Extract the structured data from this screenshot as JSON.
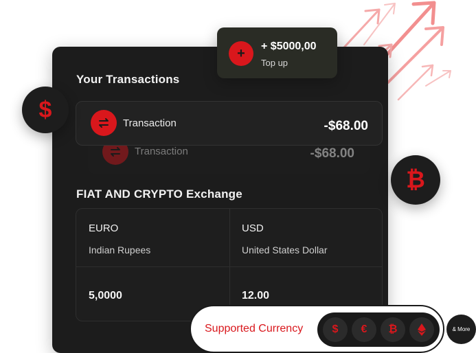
{
  "colors": {
    "accent": "#d9171c",
    "card_bg": "#1c1c1c",
    "text": "#f2f2f2"
  },
  "topup": {
    "amount": "+ $5000,00",
    "label": "Top up",
    "icon": "plus-icon"
  },
  "transactions": {
    "title": "Your Transactions",
    "items": [
      {
        "label": "Transaction",
        "amount": "-$68.00",
        "icon": "exchange-arrows-icon"
      },
      {
        "label": "Transaction",
        "amount": "-$68.00",
        "icon": "exchange-arrows-icon"
      }
    ]
  },
  "exchange": {
    "title": "FIAT AND CRYPTO Exchange",
    "columns": [
      {
        "code": "EURO",
        "name": "Indian Rupees",
        "value": "5,0000"
      },
      {
        "code": "USD",
        "name": "United States Dollar",
        "value": "12.00"
      }
    ]
  },
  "floating_icons": [
    "dollar-icon",
    "bitcoin-icon"
  ],
  "supported": {
    "label": "Supported Currency",
    "icons": [
      "dollar-icon",
      "euro-icon",
      "bitcoin-icon",
      "ethereum-icon"
    ],
    "more_label": "& More"
  }
}
